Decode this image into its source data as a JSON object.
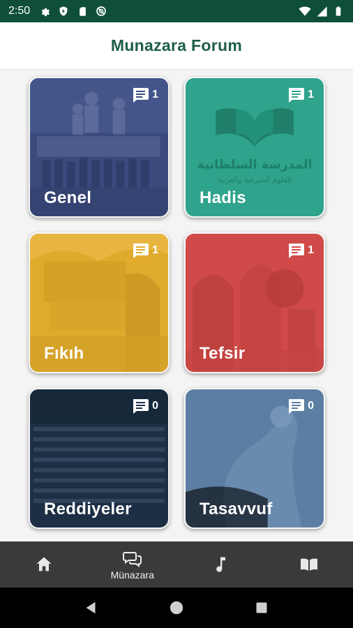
{
  "status_bar": {
    "time": "2:50",
    "left_icons": [
      "gear-icon",
      "shield-icon",
      "sim-icon",
      "dnd-icon"
    ],
    "right_icons": [
      "wifi-icon",
      "signal-icon",
      "battery-icon"
    ]
  },
  "app_bar": {
    "title": "Munazara Forum"
  },
  "categories": [
    {
      "title": "Genel",
      "count": "1",
      "color": "#3b4a7d"
    },
    {
      "title": "Hadis",
      "count": "1",
      "color": "#2fa38c"
    },
    {
      "title": "Fıkıh",
      "count": "1",
      "color": "#e0ab2c"
    },
    {
      "title": "Tefsir",
      "count": "1",
      "color": "#cf4a48"
    },
    {
      "title": "Reddiyeler",
      "count": "0",
      "color": "#1c2f45"
    },
    {
      "title": "Tasavvuf",
      "count": "0",
      "color": "#5c7ea2"
    }
  ],
  "hadis_logo": {
    "line1": "المدرسة السلطانية",
    "line2": "للعلوم الشرعية والعربية"
  },
  "bottom_nav": [
    {
      "icon": "home-icon",
      "label": ""
    },
    {
      "icon": "chat-bubbles-icon",
      "label": "Münazara"
    },
    {
      "icon": "music-note-icon",
      "label": ""
    },
    {
      "icon": "book-icon",
      "label": ""
    }
  ],
  "colors": {
    "status_bar": "#0f4f3a",
    "title": "#1d5e4a",
    "nav_bg": "#3a3a3a"
  }
}
